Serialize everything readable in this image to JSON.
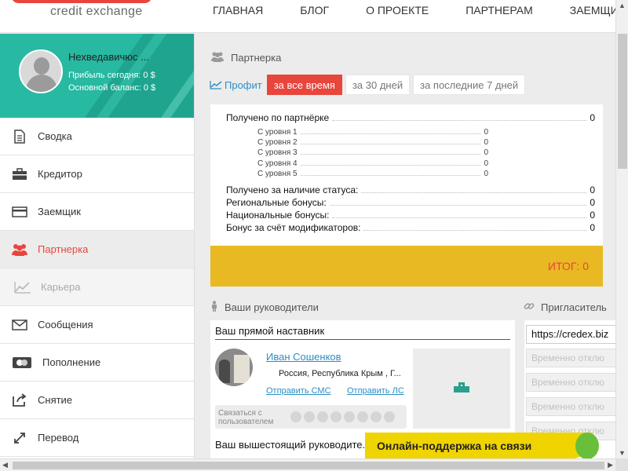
{
  "header": {
    "logo_sub": "credit exchange",
    "nav": [
      "ГЛАВНАЯ",
      "БЛОГ",
      "О ПРОЕКТЕ",
      "ПАРТНЕРАМ",
      "ЗАЕМЩИК"
    ]
  },
  "profile": {
    "name": "Нехведавичюс ...",
    "profit_today": "Прибыль сегодня: 0 $",
    "balance": "Основной баланс: 0 $"
  },
  "sidebar": {
    "items": [
      {
        "label": "Сводка",
        "icon": "document-icon"
      },
      {
        "label": "Кредитор",
        "icon": "briefcase-icon"
      },
      {
        "label": "Заемщик",
        "icon": "card-icon"
      },
      {
        "label": "Партнерка",
        "icon": "users-icon",
        "active": true
      },
      {
        "label": "Карьера",
        "icon": "chart-icon",
        "disabled": true
      },
      {
        "label": "Сообщения",
        "icon": "envelope-icon"
      },
      {
        "label": "Пополнение",
        "icon": "payment-card-icon"
      },
      {
        "label": "Снятие",
        "icon": "share-icon"
      },
      {
        "label": "Перевод",
        "icon": "arrows-icon"
      }
    ]
  },
  "main": {
    "section_title": "Партнерка",
    "profit_label": "Профит",
    "tabs": [
      "за все время",
      "за 30 дней",
      "за последние 7 дней"
    ],
    "active_tab": 0,
    "received_partner": {
      "label": "Получено по партнёрке",
      "value": "0"
    },
    "levels": [
      {
        "label": "С уровня 1",
        "value": "0"
      },
      {
        "label": "С уровня 2",
        "value": "0"
      },
      {
        "label": "С уровня 3",
        "value": "0"
      },
      {
        "label": "С уровня 4",
        "value": "0"
      },
      {
        "label": "С уровня 5",
        "value": "0"
      }
    ],
    "other_rows": [
      {
        "label": "Получено за наличие статуса:",
        "value": "0"
      },
      {
        "label": "Региональные бонусы:",
        "value": "0"
      },
      {
        "label": "Национальные бонусы:",
        "value": "0"
      },
      {
        "label": "Бонус за счёт модификаторов:",
        "value": "0"
      }
    ],
    "total": "ИТОГ: 0"
  },
  "leaders": {
    "title": "Ваши руководители",
    "direct_title": "Ваш прямой наставник",
    "name": "Иван Сошенков",
    "location": "Россия, Республика Крым , Г...",
    "send_sms": "Отправить СМС",
    "send_ls": "Отправить ЛС",
    "contact_label": "Связаться с пользователем",
    "senior_title": "Ваш вышестоящий руководите..."
  },
  "invite": {
    "title": "Пригласитель",
    "url": "https://credex.biz",
    "disabled_items": [
      "Временно отклю",
      "Временно отклю",
      "Временно отклю",
      "Временно отклю"
    ]
  },
  "support": {
    "label": "Онлайн-поддержка на связи"
  },
  "colors": {
    "accent_red": "#e8453c",
    "teal": "#27b9a2",
    "yellow_total": "#e8b923",
    "link_blue": "#2b8fc6"
  }
}
